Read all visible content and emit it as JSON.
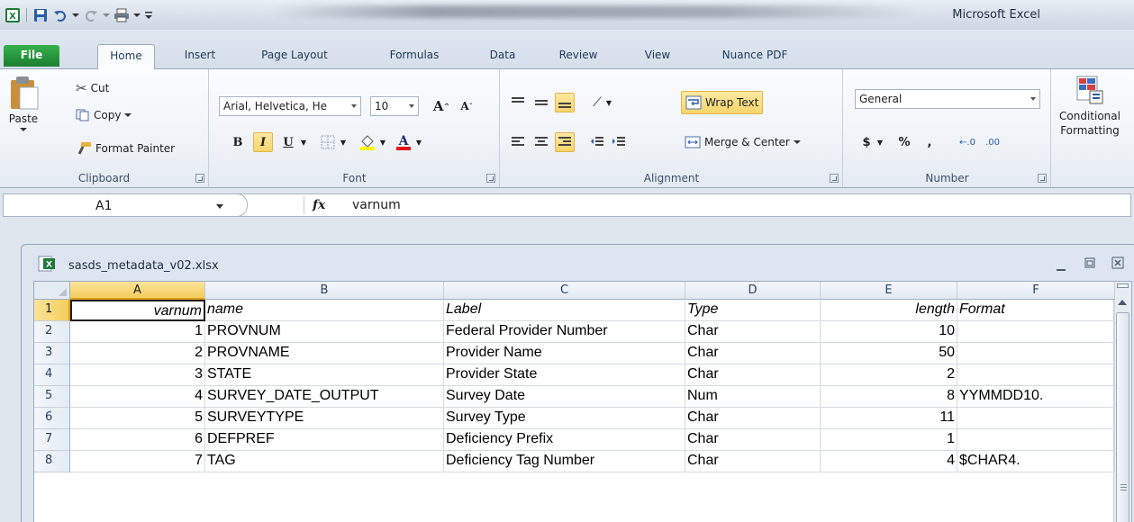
{
  "app": {
    "title": "Microsoft Excel"
  },
  "ribbon_tabs": [
    "File",
    "Home",
    "Insert",
    "Page Layout",
    "Formulas",
    "Data",
    "Review",
    "View",
    "Nuance PDF"
  ],
  "active_tab": "Home",
  "clipboard": {
    "paste_label": "Paste",
    "cut_label": "Cut",
    "copy_label": "Copy",
    "format_painter_label": "Format Painter",
    "group_label": "Clipboard"
  },
  "font": {
    "font_name": "Arial, Helvetica, He",
    "font_size": "10",
    "group_label": "Font"
  },
  "alignment": {
    "wrap_text_label": "Wrap Text",
    "merge_center_label": "Merge & Center",
    "group_label": "Alignment"
  },
  "number": {
    "format_value": "General",
    "group_label": "Number"
  },
  "styles": {
    "conditional_label_1": "Conditional",
    "conditional_label_2": "Formatting"
  },
  "formula_bar": {
    "name_box": "A1",
    "fx_label": "fx",
    "content": "varnum"
  },
  "workbook": {
    "filename": "sasds_metadata_v02.xlsx",
    "columns": [
      "A",
      "B",
      "C",
      "D",
      "E",
      "F"
    ],
    "row_numbers": [
      "1",
      "2",
      "3",
      "4",
      "5",
      "6",
      "7",
      "8"
    ],
    "rows": [
      [
        "varnum",
        "name",
        "Label",
        "Type",
        "length",
        "Format"
      ],
      [
        "1",
        "PROVNUM",
        "Federal Provider Number",
        "Char",
        "10",
        ""
      ],
      [
        "2",
        "PROVNAME",
        "Provider Name",
        "Char",
        "50",
        ""
      ],
      [
        "3",
        "STATE",
        "Provider State",
        "Char",
        "2",
        ""
      ],
      [
        "4",
        "SURVEY_DATE_OUTPUT",
        "Survey Date",
        "Num",
        "8",
        "YYMMDD10."
      ],
      [
        "5",
        "SURVEYTYPE",
        "Survey Type",
        "Char",
        "11",
        ""
      ],
      [
        "6",
        "DEFPREF",
        "Deficiency Prefix",
        "Char",
        "1",
        ""
      ],
      [
        "7",
        "TAG",
        "Deficiency Tag Number",
        "Char",
        "4",
        "$CHAR4."
      ]
    ]
  },
  "colors": {
    "file_tab": "#1d7e32",
    "selection_header": "#f4cd5c",
    "highlight_button": "#f8d46b"
  }
}
